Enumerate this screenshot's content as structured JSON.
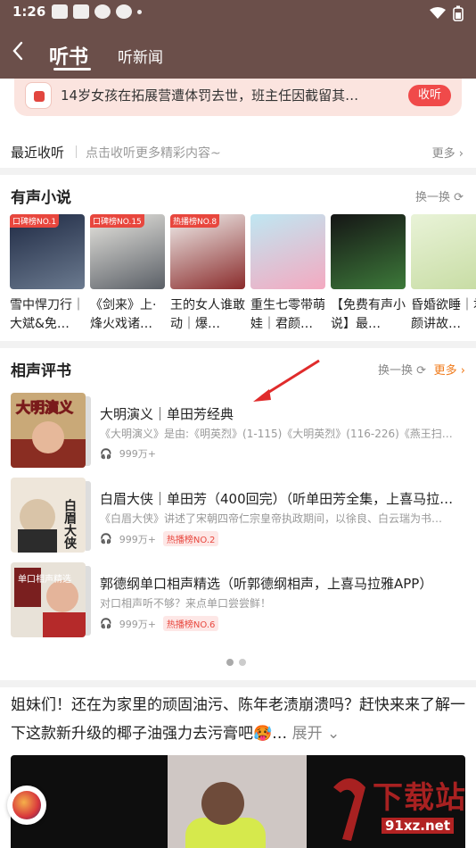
{
  "status_bar": {
    "time": "1:26"
  },
  "header": {
    "tab_active": "听书",
    "tab_other": "听新闻"
  },
  "banner": {
    "text": "14岁女孩在拓展营遭体罚去世，班主任因截留其…",
    "button": "收听"
  },
  "recent": {
    "label": "最近收听",
    "hint": "点击收听更多精彩内容~",
    "more": "更多 ›"
  },
  "audio_novels": {
    "title": "有声小说",
    "swap": "换一换 ⟳",
    "books": [
      {
        "badge": "口碑榜NO.1",
        "name": "雪中悍刀行｜大斌&免…",
        "c1": "#1f2a44",
        "c2": "#6b7a8f"
      },
      {
        "badge": "口碑榜NO.15",
        "name": "《剑来》上·烽火戏诸…",
        "c1": "#e8e6e0",
        "c2": "#5a5f66"
      },
      {
        "badge": "热播榜NO.8",
        "name": "王的女人谁敢动｜爆…",
        "c1": "#f1f0ee",
        "c2": "#8a2b2b"
      },
      {
        "badge": "",
        "name": "重生七零带萌娃｜君颜…",
        "c1": "#bfe7f2",
        "c2": "#f4a9c0"
      },
      {
        "badge": "",
        "name": "【免费有声小说】最…",
        "c1": "#151515",
        "c2": "#3d7a3a"
      },
      {
        "badge": "",
        "name": "昏婚欲睡｜君颜讲故…",
        "c1": "#e9f3d8",
        "c2": "#c7dca3"
      }
    ]
  },
  "crosstalk": {
    "title": "相声评书",
    "swap": "换一换 ⟳",
    "more": "更多 ›",
    "items": [
      {
        "title": "大明演义｜单田芳经典",
        "desc": "《大明演义》是由:《明英烈》(1-115)《大明英烈》(116-226)《燕王扫…",
        "plays": "999万+",
        "tag": ""
      },
      {
        "title": "白眉大侠｜单田芳（400回完）（听单田芳全集，上喜马拉…",
        "desc": "《白眉大侠》讲述了宋朝四帝仁宗皇帝执政期间，以徐良、白云瑞为书…",
        "plays": "999万+",
        "tag": "热播榜NO.2"
      },
      {
        "title": "郭德纲单口相声精选（听郭德纲相声，上喜马拉雅APP）",
        "desc": "对口相声听不够？来点单口尝尝鲜！",
        "plays": "999万+",
        "tag": "热播榜NO.6"
      }
    ],
    "cover_texts": [
      "大明演义",
      "白眉大侠",
      "单口相声精选"
    ]
  },
  "ad": {
    "text": "姐妹们！还在为家里的顽固油污、陈年老渍崩溃吗？赶快来来了解一下这款新升级的椰子油强力去污膏吧🥵…",
    "expand": "展开 ⌄"
  },
  "watermark": {
    "big": "下载站",
    "url": "91xz.net"
  }
}
